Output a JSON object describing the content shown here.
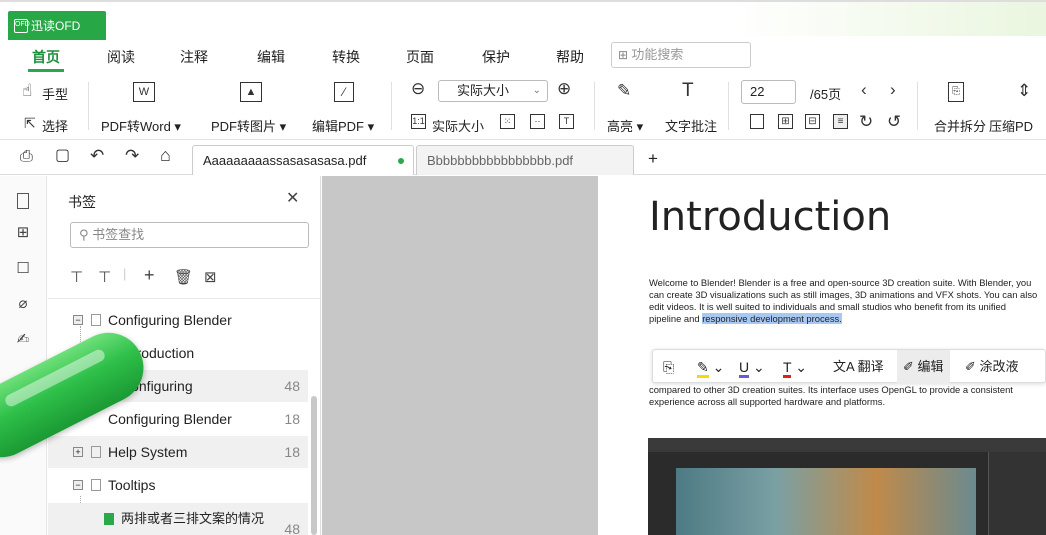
{
  "app": {
    "name": "迅读OFD"
  },
  "menu": {
    "tabs": [
      "首页",
      "阅读",
      "注释",
      "编辑",
      "转换",
      "页面",
      "保护",
      "帮助"
    ],
    "search_placeholder": "功能搜索"
  },
  "ribbon": {
    "hand_label": "手型",
    "select_label": "选择",
    "pdf_to_word": "PDF转Word ▾",
    "pdf_to_image": "PDF转图片 ▾",
    "edit_pdf": "编辑PDF ▾",
    "zoom_value": "实际大小",
    "actual_size_label": "实际大小",
    "highlight_label": "高亮 ▾",
    "text_comment_label": "文字批注",
    "page_current": "22",
    "page_total": "/65页",
    "merge_split_label": "合并拆分",
    "compress_label": "压缩PD"
  },
  "tabs": {
    "doc1": "Aaaaaaaaassasasasasa.pdf",
    "doc2": "Bbbbbbbbbbbbbbbbb.pdf",
    "add": "+"
  },
  "bookmarks": {
    "title": "书签",
    "search_placeholder": "书签查找",
    "items": [
      {
        "label": "Configuring Blender",
        "num": ""
      },
      {
        "label": "Introduction",
        "num": ""
      },
      {
        "label": "Configuring",
        "num": "48"
      },
      {
        "label": "Configuring Blender",
        "num": "18"
      },
      {
        "label": "Help System",
        "num": "18"
      },
      {
        "label": "Tooltips",
        "num": ""
      },
      {
        "label": "两排或者三排文案的情况",
        "num": "48"
      }
    ]
  },
  "document": {
    "heading": "Introduction",
    "para1": "Welcome to Blender! Blender is a free and open-source 3D creation suite. With Blender, you can create 3D visualizations such as still images, 3D animations and VFX shots. You can also edit videos. It is well suited to individuals and small studios who benefit from its unified pipeline and",
    "para1_highlight": "responsive development process.",
    "para2": "compared to other 3D creation suites. Its interface uses OpenGL to provide a consistent experience across all supported hardware and platforms."
  },
  "float_toolbar": {
    "translate": "翻译",
    "edit": "编辑",
    "modify": "涂改液"
  },
  "colors": {
    "accent": "#2ba84a",
    "highlight": "#a7c8f2"
  }
}
